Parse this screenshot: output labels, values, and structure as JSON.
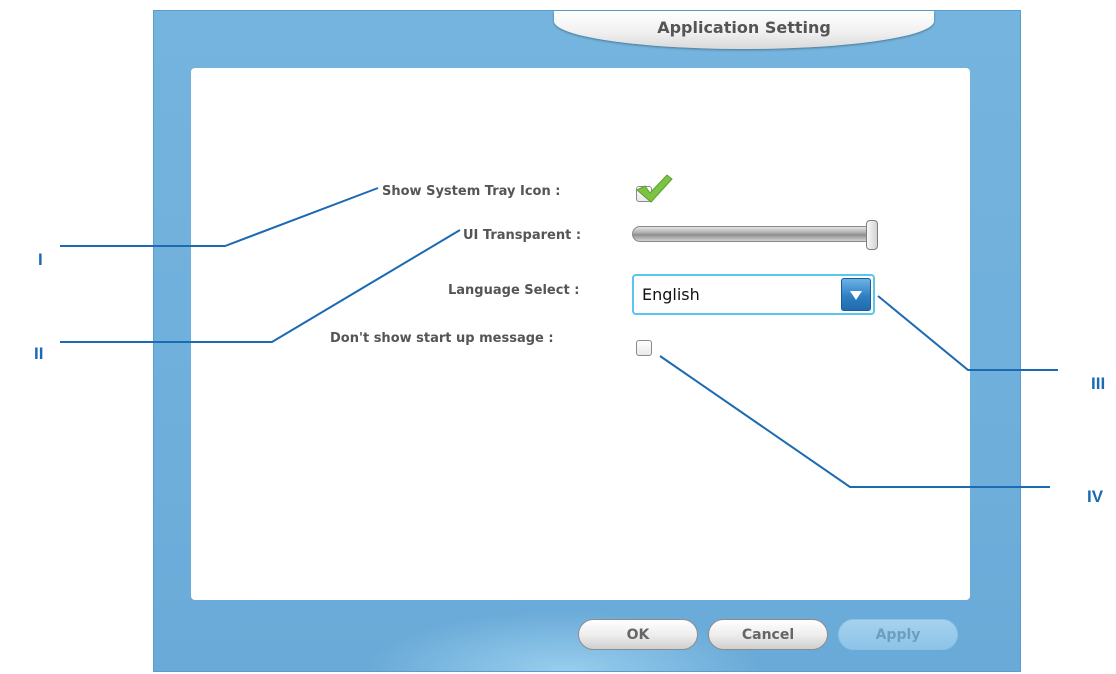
{
  "dialog": {
    "title": "Application Setting"
  },
  "settings": {
    "tray_label": "Show System Tray Icon :",
    "tray_checked": true,
    "transparent_label": "UI Transparent :",
    "transparency_level": 1.0,
    "language_label": "Language Select :",
    "language_value": "English",
    "startup_label": "Don't show start up message :",
    "startup_checked": false
  },
  "buttons": {
    "ok": "OK",
    "cancel": "Cancel",
    "apply": "Apply",
    "apply_enabled": false
  },
  "callouts": {
    "c1": "I",
    "c2": "II",
    "c3": "III",
    "c4": "IV"
  },
  "colors": {
    "frame": "#6eaedb",
    "callout": "#1b6ab2",
    "checkmark": "#7cc243",
    "select_border": "#58c6ef"
  },
  "icons": {
    "checkmark": "checkmark-icon",
    "dropdown": "triangle-down-icon"
  }
}
